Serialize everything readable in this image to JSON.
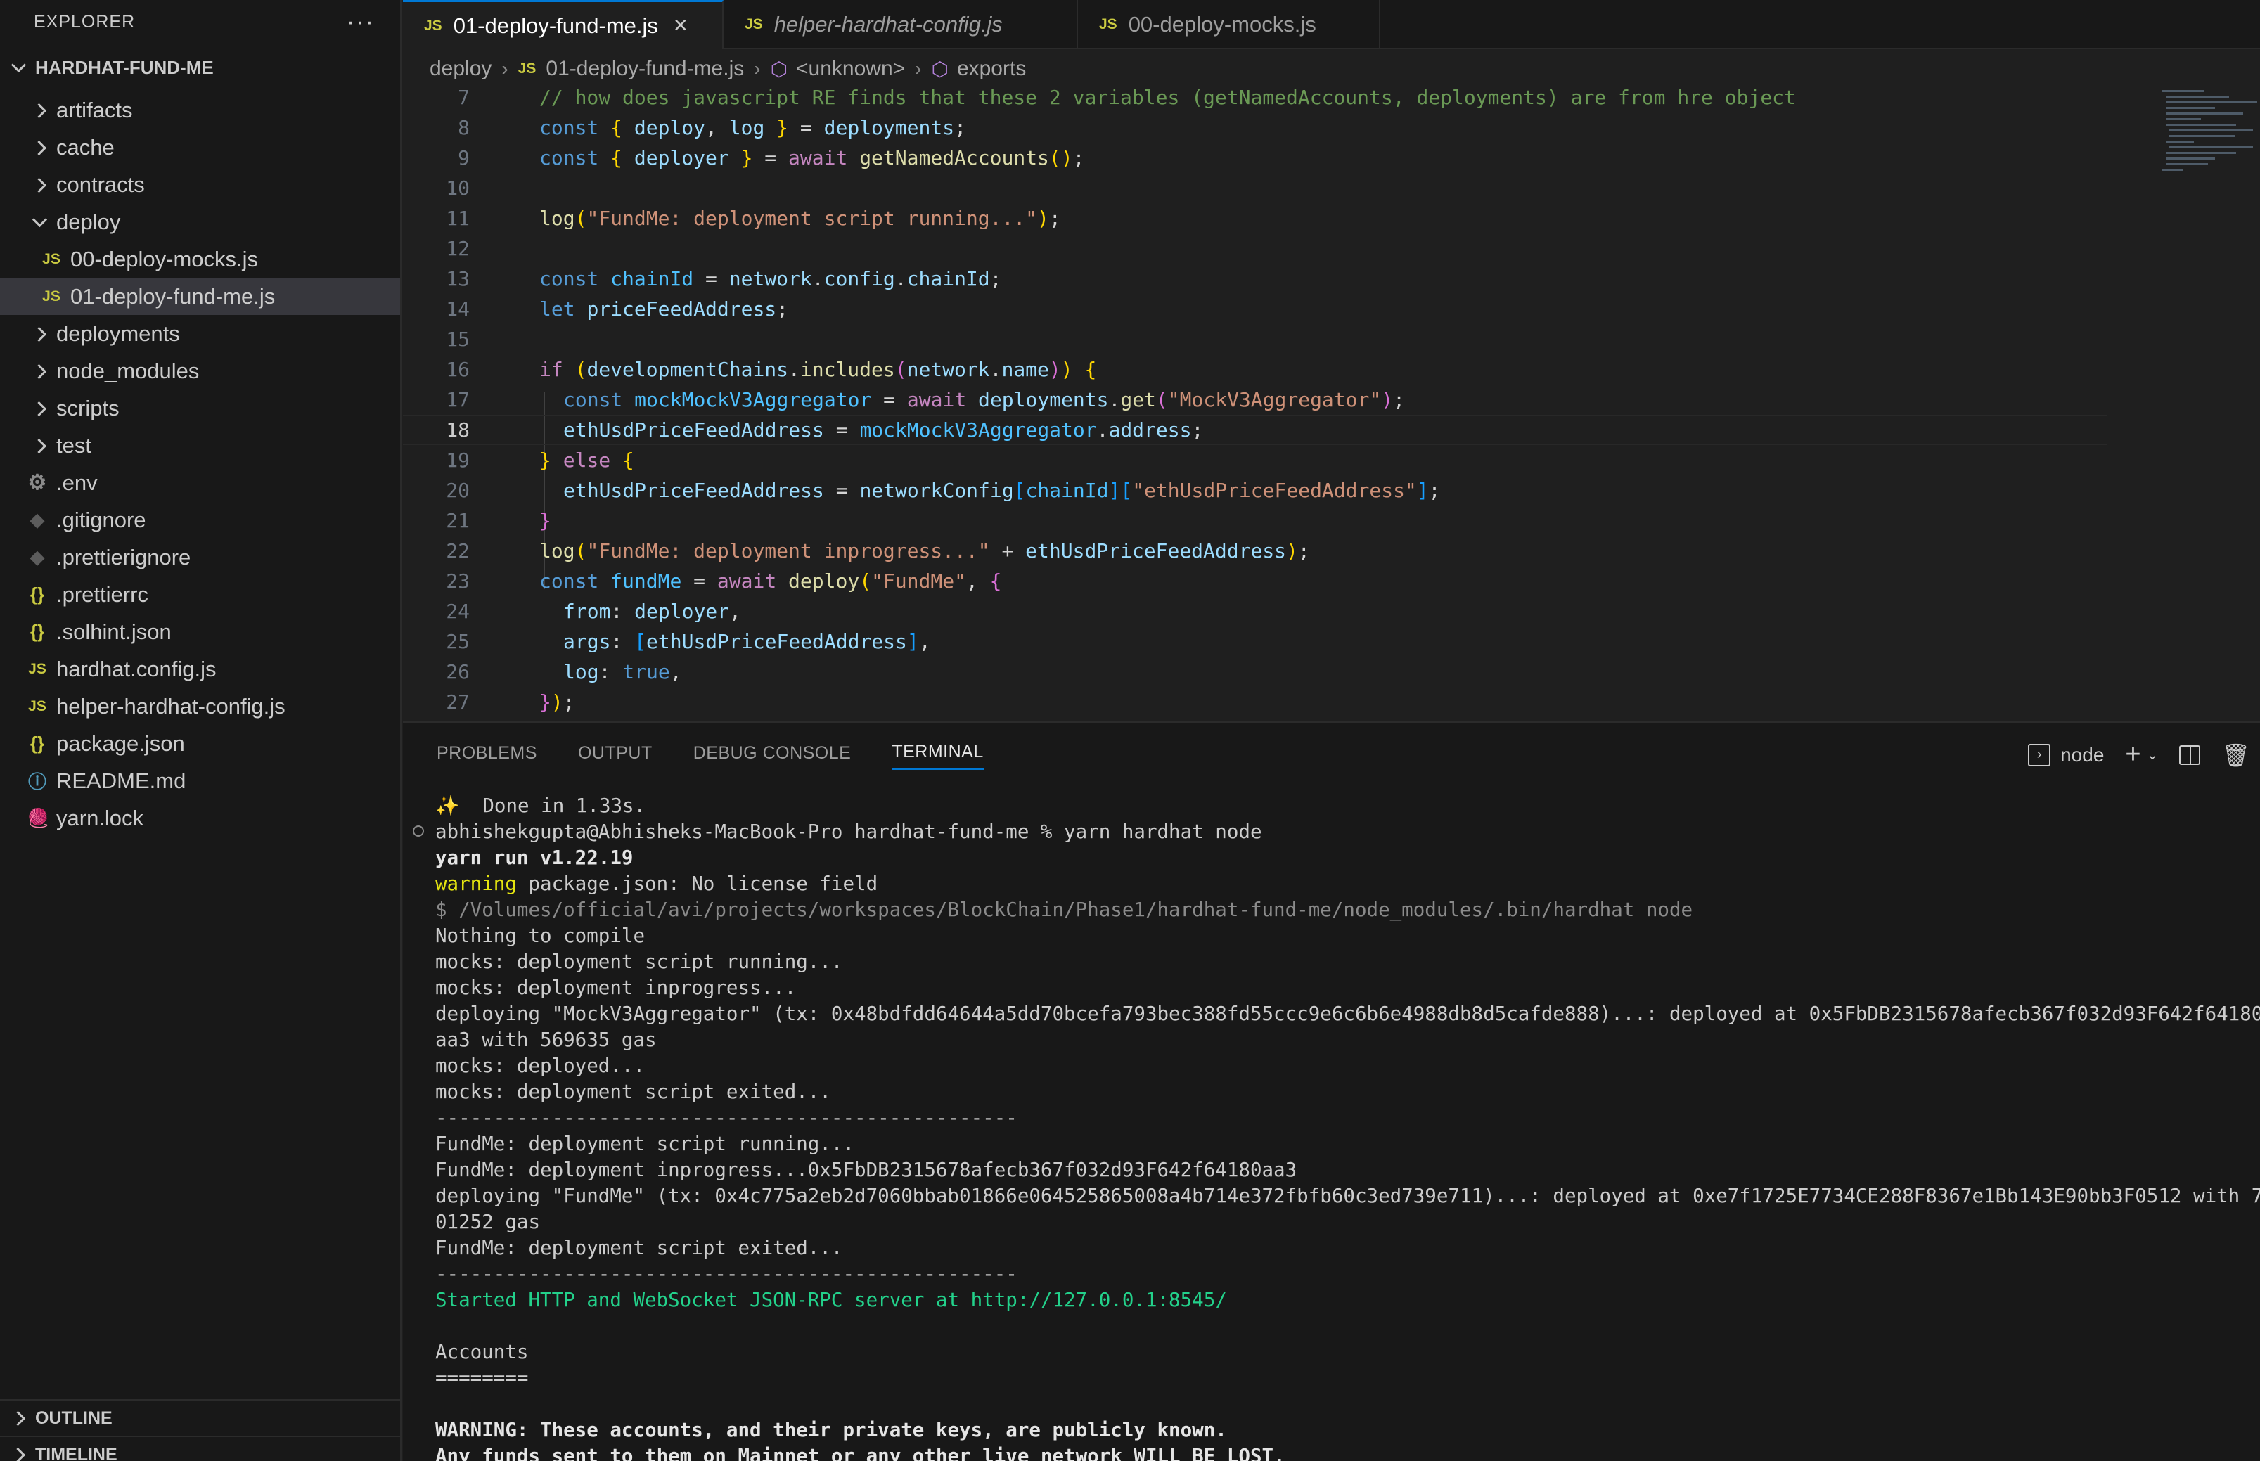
{
  "sidebar": {
    "title": "EXPLORER",
    "more": "···",
    "project": "HARDHAT-FUND-ME",
    "items": [
      {
        "label": "artifacts",
        "type": "folder"
      },
      {
        "label": "cache",
        "type": "folder"
      },
      {
        "label": "contracts",
        "type": "folder"
      },
      {
        "label": "deploy",
        "type": "folder-open"
      },
      {
        "label": "00-deploy-mocks.js",
        "type": "js"
      },
      {
        "label": "01-deploy-fund-me.js",
        "type": "js"
      },
      {
        "label": "deployments",
        "type": "folder"
      },
      {
        "label": "node_modules",
        "type": "folder"
      },
      {
        "label": "scripts",
        "type": "folder"
      },
      {
        "label": "test",
        "type": "folder"
      },
      {
        "label": ".env",
        "type": "gear"
      },
      {
        "label": ".gitignore",
        "type": "diamond"
      },
      {
        "label": ".prettierignore",
        "type": "diamond"
      },
      {
        "label": ".prettierrc",
        "type": "json"
      },
      {
        "label": ".solhint.json",
        "type": "json"
      },
      {
        "label": "hardhat.config.js",
        "type": "js"
      },
      {
        "label": "helper-hardhat-config.js",
        "type": "js"
      },
      {
        "label": "package.json",
        "type": "json"
      },
      {
        "label": "README.md",
        "type": "info"
      },
      {
        "label": "yarn.lock",
        "type": "yarn"
      }
    ],
    "outline": "OUTLINE",
    "timeline": "TIMELINE"
  },
  "tabs": [
    {
      "label": "01-deploy-fund-me.js",
      "icon": "JS"
    },
    {
      "label": "helper-hardhat-config.js",
      "icon": "JS"
    },
    {
      "label": "00-deploy-mocks.js",
      "icon": "JS"
    }
  ],
  "tab_close": "×",
  "breadcrumb": {
    "folder": "deploy",
    "file": "01-deploy-fund-me.js",
    "file_icon": "JS",
    "symbol1": "<unknown>",
    "symbol2": "exports"
  },
  "editor": {
    "line_numbers": [
      "7",
      "8",
      "9",
      "10",
      "11",
      "12",
      "13",
      "14",
      "15",
      "16",
      "17",
      "18",
      "19",
      "20",
      "21",
      "22",
      "23",
      "24",
      "25",
      "26",
      "27"
    ],
    "current_line": "18",
    "code": {
      "l7": "// how does javascript RE finds that these 2 variables (getNamedAccounts, deployments) are from hre object",
      "deploy": "deploy",
      "log": "log",
      "deployments": "deployments",
      "deployer": "deployer",
      "getNamedAccounts": "getNamedAccounts",
      "log_running": "\"FundMe: deployment script running...\"",
      "chainId": "chainId",
      "network": "network",
      "config": "config",
      "priceFeedAddress": "priceFeedAddress",
      "developmentChains": "developmentChains",
      "includes": "includes",
      "name": "name",
      "mockMockV3Aggregator": "mockMockV3Aggregator",
      "get": "get",
      "mockStr": "\"MockV3Aggregator\"",
      "ethUsdPriceFeedAddress": "ethUsdPriceFeedAddress",
      "address": "address",
      "networkConfig": "networkConfig",
      "ethStr": "\"ethUsdPriceFeedAddress\"",
      "log_inprogress": "\"FundMe: deployment inprogress...\"",
      "fundMe": "fundMe",
      "fundMeStr": "\"FundMe\"",
      "from": "from",
      "args": "args",
      "logKey": "log",
      "true": "true"
    }
  },
  "panel": {
    "tabs": [
      "PROBLEMS",
      "OUTPUT",
      "DEBUG CONSOLE",
      "TERMINAL"
    ],
    "terminal_name": "node",
    "terminal_lines": [
      "✨  Done in 1.33s.",
      "abhishekgupta@Abhisheks-MacBook-Pro hardhat-fund-me % yarn hardhat node",
      "yarn run v1.22.19",
      "warning",
      " package.json: No license field",
      "$ /Volumes/official/avi/projects/workspaces/BlockChain/Phase1/hardhat-fund-me/node_modules/.bin/hardhat node",
      "Nothing to compile",
      "mocks: deployment script running...",
      "mocks: deployment inprogress...",
      "deploying \"MockV3Aggregator\" (tx: 0x48bdfdd64644a5dd70bcefa793bec388fd55ccc9e6c6b6e4988db8d5cafde888)...: deployed at 0x5FbDB2315678afecb367f032d93F642f64180",
      "aa3 with 569635 gas",
      "mocks: deployed...",
      "mocks: deployment script exited...",
      "--------------------------------------------------",
      "FundMe: deployment script running...",
      "FundMe: deployment inprogress...0x5FbDB2315678afecb367f032d93F642f64180aa3",
      "deploying \"FundMe\" (tx: 0x4c775a2eb2d7060bbab01866e064525865008a4b714e372fbfb60c3ed739e711)...: deployed at 0xe7f1725E7734CE288F8367e1Bb143E90bb3F0512 with 7",
      "01252 gas",
      "FundMe: deployment script exited...",
      "--------------------------------------------------",
      "Started HTTP and WebSocket JSON-RPC server at http://127.0.0.1:8545/",
      "Accounts",
      "========",
      "WARNING: These accounts, and their private keys, are publicly known.",
      "Any funds sent to them on Mainnet or any other live network WILL BE LOST."
    ]
  }
}
